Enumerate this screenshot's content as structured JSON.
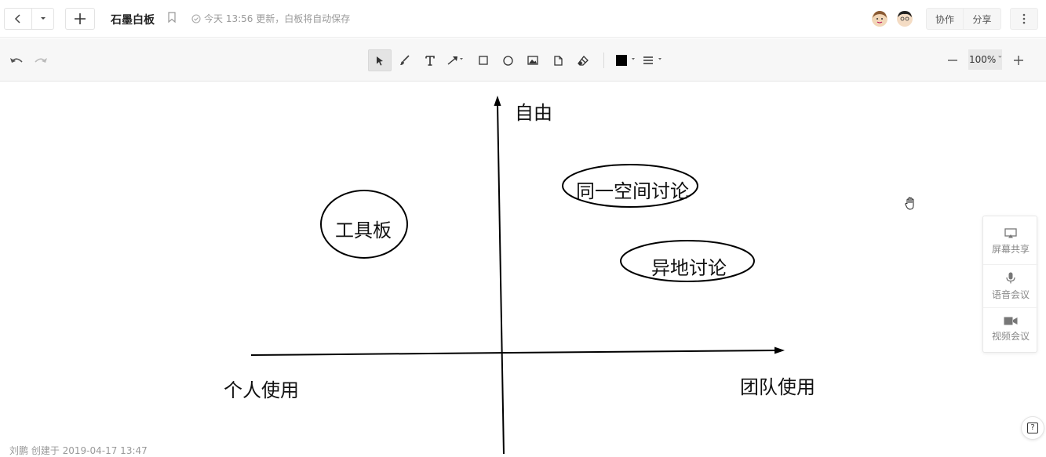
{
  "header": {
    "title": "石墨白板",
    "status": "今天 13:56 更新，白板将自动保存",
    "collaborate_label": "协作",
    "share_label": "分享"
  },
  "toolbar": {
    "zoom": "100%",
    "stroke_color": "#000000"
  },
  "board": {
    "y_axis_label": "自由",
    "x_left_label": "个人使用",
    "x_right_label": "团队使用",
    "ellipses": [
      "工具板",
      "同一空间讨论",
      "异地讨论"
    ]
  },
  "side_panel": {
    "screen_share": "屏幕共享",
    "voice_meeting": "语音会议",
    "video_meeting": "视频会议"
  },
  "footer": {
    "created_by": "刘鹏 创建于 2019-04-17 13:47"
  },
  "help_label": "?"
}
